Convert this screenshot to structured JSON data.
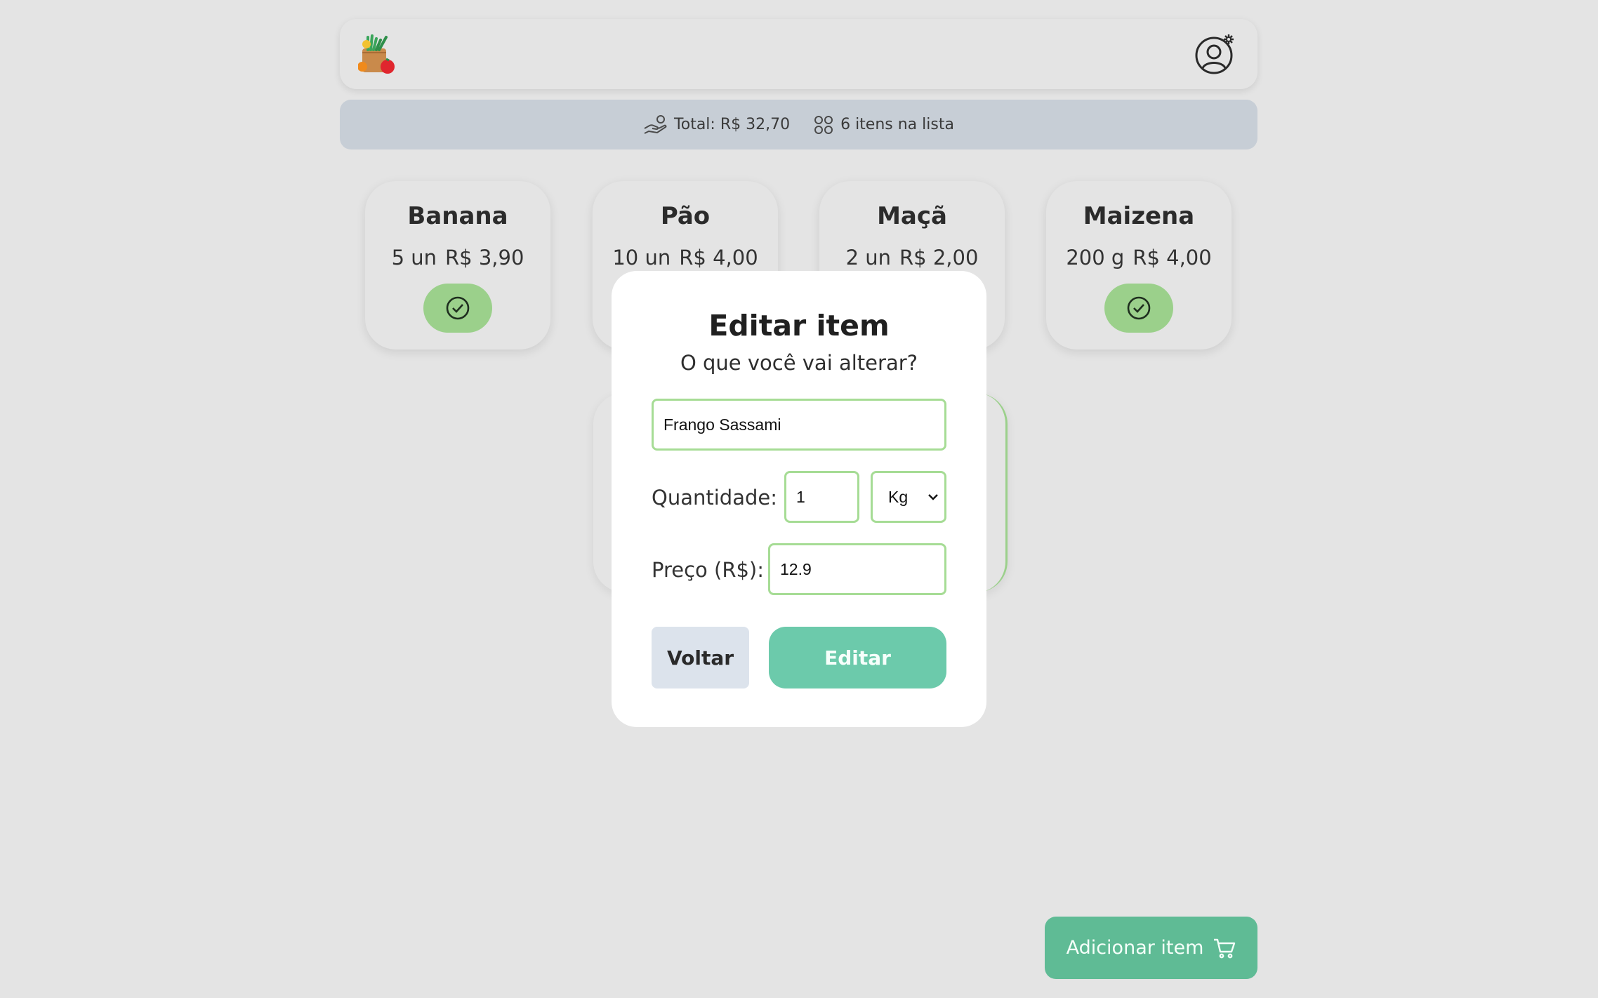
{
  "header": {
    "logo_icon": "grocery-bag-icon",
    "user_icon": "user-settings-icon"
  },
  "summary": {
    "total_text": "Total: R$ 32,70",
    "count_text": "6 itens na lista"
  },
  "items": [
    {
      "name": "Banana",
      "qty": "5 un",
      "price": "R$ 3,90",
      "checked": true
    },
    {
      "name": "Pão",
      "qty": "10 un",
      "price": "R$ 4,00",
      "checked": false
    },
    {
      "name": "Maçã",
      "qty": "2 un",
      "price": "R$ 2,00",
      "checked": false
    },
    {
      "name": "Maizena",
      "qty": "200 g",
      "price": "R$ 4,00",
      "checked": true
    }
  ],
  "modal": {
    "title": "Editar item",
    "subtitle": "O que você vai alterar?",
    "name_value": "Frango Sassami",
    "qty_label": "Quantidade:",
    "qty_value": "1",
    "unit_value": "Kg",
    "price_label": "Preço (R$):",
    "price_value": "12.9",
    "back_label": "Voltar",
    "edit_label": "Editar"
  },
  "add_button": {
    "label": "Adicionar item"
  },
  "colors": {
    "accent_green": "#9bd08b",
    "edit_teal": "#6ccaab",
    "add_green": "#5fbb95",
    "summary_bg": "#c7ced6"
  }
}
